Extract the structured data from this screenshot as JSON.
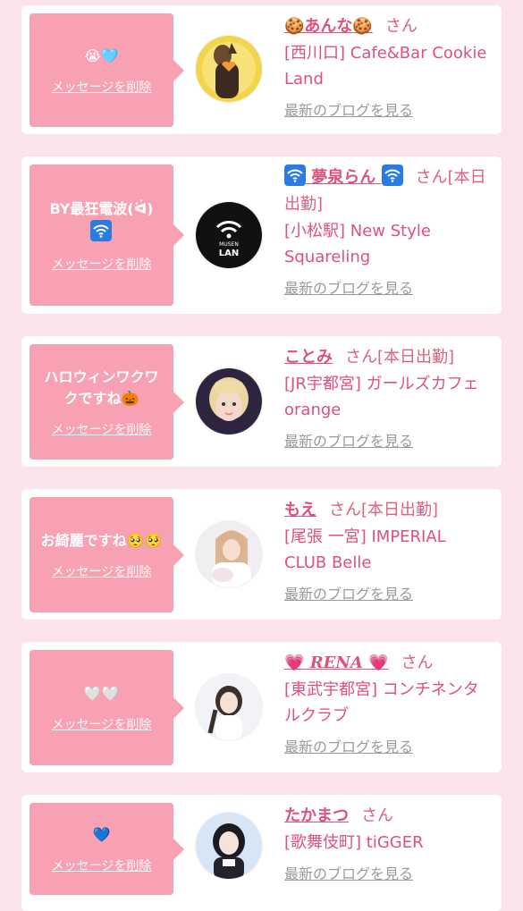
{
  "blog_label": "最新のブログを見る",
  "delete_label": "メッセージを削除",
  "san_label": "さん",
  "colors": {
    "accent": "#e0507a",
    "bubble": "#f8a1b3",
    "background": "#fbe4ea"
  },
  "cards": [
    {
      "message": "😭🩵",
      "name_prefix": "🍪",
      "name": "あんな",
      "name_suffix": "🍪",
      "status": "",
      "shop": "[西川口] Cafe&Bar Cookie Land"
    },
    {
      "message_1": "BY最狂電波(ᐛ)",
      "message_icon": "wifi-icon",
      "name": "夢泉らん",
      "name_icon": "wifi-icon",
      "status": "[本日出勤]",
      "shop": "[小松駅] New Style Squareling",
      "avatar_text_1": "MUSEN",
      "avatar_text_2": "LAN"
    },
    {
      "message": "ハロウィンワクワクですね🎃",
      "name": "ことみ",
      "status": "[本日出勤]",
      "shop": "[JR宇都宮] ガールズカフェ orange"
    },
    {
      "message": "お綺麗ですね🥺🥺",
      "name": "もえ",
      "status": "[本日出勤]",
      "shop": "[尾張 一宮] IMPERIAL CLUB Belle"
    },
    {
      "message": "🤍🤍",
      "name_prefix": "💗",
      "name": "RENA",
      "name_suffix": "💗",
      "status": "",
      "shop": "[東武宇都宮] コンチネンタルクラブ"
    },
    {
      "message": "💙",
      "name": "たかまつ",
      "status": "",
      "shop": "[歌舞伎町] tiGGER"
    }
  ]
}
